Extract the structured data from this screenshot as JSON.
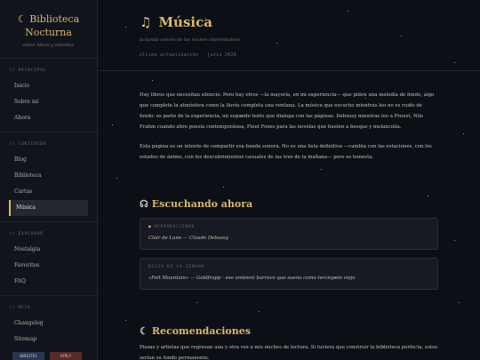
{
  "sidebar": {
    "brand_line1": "Biblioteca",
    "brand_line2": "Nocturna",
    "tagline": "entre libros y estrellas",
    "sections": [
      {
        "heading": "// PRINCIPAL",
        "items": [
          "Inicio",
          "Sobre mí",
          "Ahora"
        ]
      },
      {
        "heading": "// CONTENIDO",
        "items": [
          "Blog",
          "Biblioteca",
          "Cartas",
          "Música"
        ]
      },
      {
        "heading": "// EXPLORAR",
        "items": [
          "Nostalgia",
          "Favoritos",
          "FAQ"
        ]
      },
      {
        "heading": "// META",
        "items": [
          "Changelog",
          "Sitemap"
        ]
      }
    ],
    "active_item": "Música",
    "badges": [
      "WEBSITES",
      "HTML5"
    ]
  },
  "page": {
    "title": "Música",
    "subtitle": "la banda sonora de las noches interminables",
    "updated": "última actualización · junio 2026",
    "intro_p1": "Hay libros que necesitan silencio. Pero hay otros —la mayoría, en mi experiencia— que piden una melodía de fondo, algo que complete la atmósfera como la lluvia completa una ventana. La música que escucho mientras leo no es ruido de fondo: es parte de la experiencia, un segundo texto que dialoga con las páginas. Debussy mientras leo a Proust, Nils Frahm cuando abro poesía contemporánea, Fleet Foxes para las novelas que huelen a bosque y melancolía.",
    "intro_p2": "Esta página es un intento de compartir esa banda sonora. No es una lista definitiva —cambia con las estaciones, con los estados de ánimo, con los descubrimientos casuales de las tres de la mañana— pero es honesta.",
    "now_title": "Escuchando ahora",
    "now_cards": [
      {
        "label": "REPRODUCIENDO",
        "text": "Clair de Lune — Claude Debussy"
      },
      {
        "label": "DISCO DE LA SEMANA",
        "text": "«Felt Mountain» — Goldfrapp · ese ambient barroco que suena como terciopelo viejo"
      }
    ],
    "rec_title": "Recomendaciones",
    "rec_p1": "Piezas y artistas que regresan una y otra vez a mis noches de lectura. Si tuviera que construir la biblioteca perfecta, estos serían su fondo permanente."
  },
  "colors": {
    "background": "#0d0f17",
    "sidebar": "#12141d",
    "accent_gold": "#d9b867",
    "text": "#c9c4b4",
    "muted": "#6e6a60"
  }
}
